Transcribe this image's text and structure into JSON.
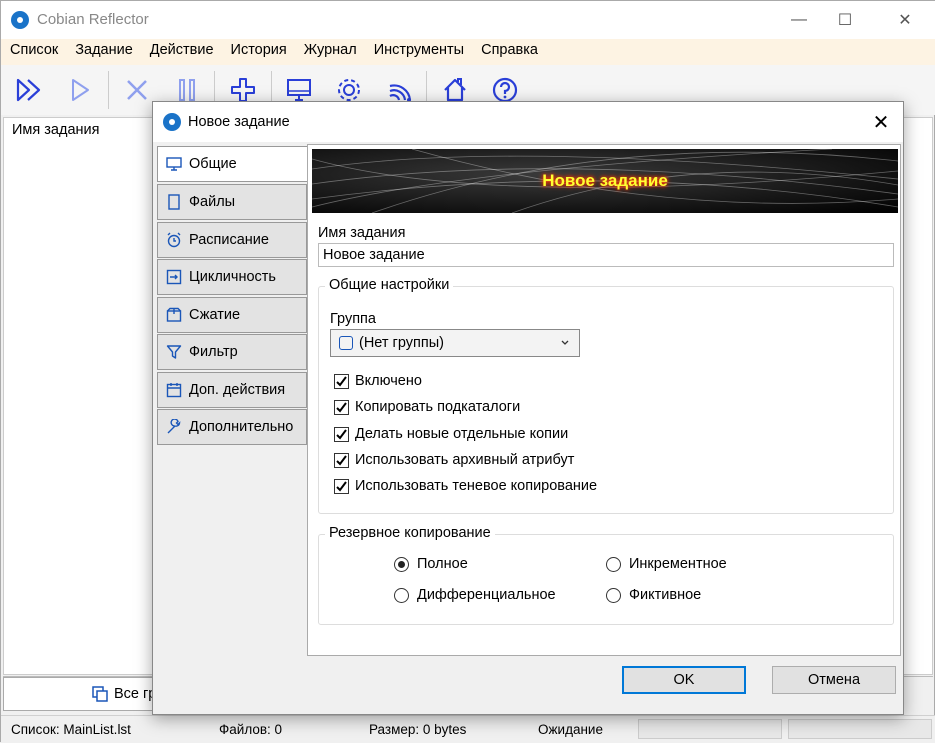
{
  "app": {
    "title": "Cobian Reflector"
  },
  "menu": [
    "Список",
    "Задание",
    "Действие",
    "История",
    "Журнал",
    "Инструменты",
    "Справка"
  ],
  "list": {
    "header": "Имя задания"
  },
  "bottom_tab": {
    "label": "Все гр"
  },
  "status": {
    "list": "Список: MainList.lst",
    "files": "Файлов: 0",
    "size": "Размер: 0 bytes",
    "state": "Ожидание"
  },
  "dialog": {
    "title": "Новое задание",
    "tabs": [
      {
        "label": "Общие",
        "icon": "monitor-icon"
      },
      {
        "label": "Файлы",
        "icon": "file-icon"
      },
      {
        "label": "Расписание",
        "icon": "alarm-icon"
      },
      {
        "label": "Цикличность",
        "icon": "cycle-icon"
      },
      {
        "label": "Сжатие",
        "icon": "archive-icon"
      },
      {
        "label": "Фильтр",
        "icon": "filter-icon"
      },
      {
        "label": "Доп. действия",
        "icon": "calendar-icon"
      },
      {
        "label": "Дополнительно",
        "icon": "wrench-icon"
      }
    ],
    "banner": "Новое задание",
    "task_name_label": "Имя задания",
    "task_name_value": "Новое задание",
    "general_group": "Общие настройки",
    "group_label": "Группа",
    "group_value": "(Нет группы)",
    "checks": [
      {
        "label": "Включено",
        "checked": true
      },
      {
        "label": "Копировать подкаталоги",
        "checked": true
      },
      {
        "label": "Делать новые отдельные копии",
        "checked": true
      },
      {
        "label": "Использовать архивный атрибут",
        "checked": true
      },
      {
        "label": "Использовать теневое копирование",
        "checked": true
      }
    ],
    "backup_group": "Резервное копирование",
    "radios": {
      "full": "Полное",
      "incremental": "Инкрементное",
      "differential": "Дифференциальное",
      "dummy": "Фиктивное"
    },
    "ok": "OK",
    "cancel": "Отмена"
  },
  "colors": {
    "toolbar_icon": "#2a3fd8",
    "menubar_bg": "#fdf3e3",
    "banner_text": "#ffff33"
  }
}
